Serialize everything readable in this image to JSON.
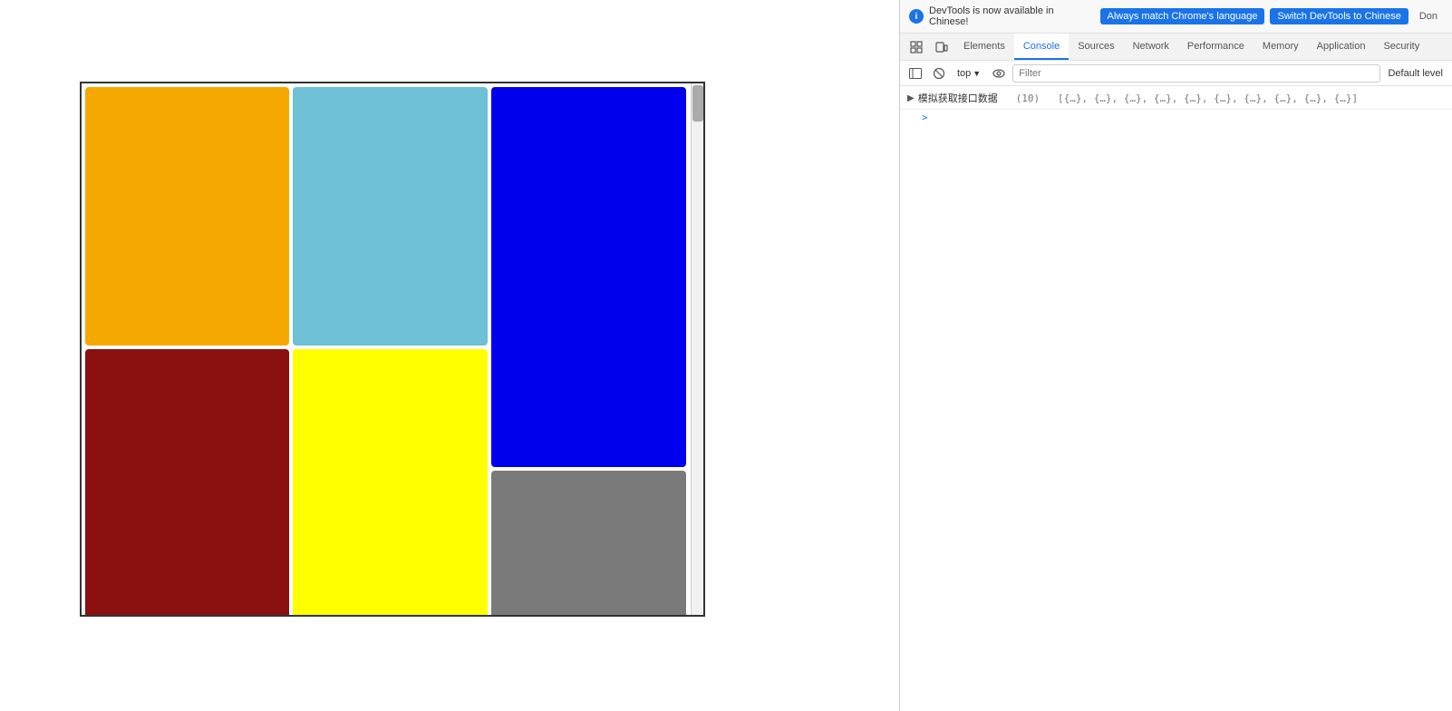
{
  "notification": {
    "info_icon": "i",
    "text": "DevTools is now available in Chinese!",
    "btn_match": "Always match Chrome's language",
    "btn_switch": "Switch DevTools to Chinese",
    "btn_dismiss": "Don"
  },
  "devtools_tabs": {
    "icons": [
      "inspector",
      "responsive"
    ],
    "tabs": [
      "Elements",
      "Console",
      "Sources",
      "Network",
      "Performance",
      "Memory",
      "Application",
      "Security"
    ]
  },
  "console_toolbar": {
    "icons": [
      "sidebar",
      "clear"
    ],
    "top_label": "top",
    "filter_placeholder": "Filter",
    "default_level": "Default level"
  },
  "console_log": {
    "main_text": "模拟获取接口数据",
    "count": "(10)",
    "items": "[{…}, {…}, {…}, {…}, {…}, {…}, {…}, {…}, {…}, {…}]",
    "expand_symbol": "▶",
    "sub_expand": ">"
  },
  "colors": {
    "orange": "#F5A800",
    "lightblue": "#6DC0D5",
    "blue": "#0000EE",
    "darkred": "#8B1010",
    "yellow": "#FFFF00",
    "gray": "#7A7A7A"
  }
}
